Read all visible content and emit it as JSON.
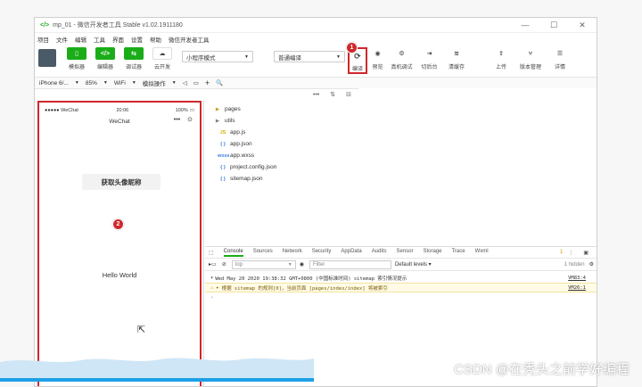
{
  "window": {
    "logo": "</>",
    "title": "mp_01 - 微信开发者工具 Stable v1.02.1911180",
    "controls": [
      "—",
      "☐",
      "✕"
    ]
  },
  "menu": [
    "项目",
    "文件",
    "编辑",
    "工具",
    "界面",
    "设置",
    "帮助",
    "微信开发者工具"
  ],
  "toolbar": {
    "left_buttons": [
      {
        "label": "模拟器",
        "glyph": "▯"
      },
      {
        "label": "编辑器",
        "glyph": "</>"
      },
      {
        "label": "调试器",
        "glyph": "⇆"
      },
      {
        "label": "云开发",
        "glyph": "☁"
      }
    ],
    "mode_select": "小程序模式",
    "compile_select": "普通编译",
    "right_buttons": [
      {
        "label": "编译",
        "glyph": "⟳"
      },
      {
        "label": "预览",
        "glyph": "◉"
      },
      {
        "label": "真机调试",
        "glyph": "⚙"
      },
      {
        "label": "切后台",
        "glyph": "⇥"
      },
      {
        "label": "清缓存",
        "glyph": "≋"
      },
      {
        "label": "上传",
        "glyph": "⇧"
      },
      {
        "label": "版本管理",
        "glyph": "⑂"
      },
      {
        "label": "详情",
        "glyph": "☰"
      }
    ],
    "badge1": "1"
  },
  "devicebar": {
    "device": "iPhone 6/...",
    "zoom": "85%",
    "network": "WiFi",
    "op": "模拟操作",
    "add": "+",
    "search": "🔍"
  },
  "phone": {
    "carrier": "●●●●● WeChat",
    "time": "20:06",
    "battery": "100%",
    "nav_title": "WeChat",
    "capsule_dots": "•••",
    "button_label": "获取头像昵称",
    "hello": "Hello World",
    "badge2": "2"
  },
  "files": [
    {
      "icon": "▶",
      "icon_color": "#c8a020",
      "name": "pages",
      "indent": 0
    },
    {
      "icon": "▶",
      "icon_color": "#7f7f7f",
      "name": "utils",
      "indent": 0
    },
    {
      "icon": "JS",
      "icon_color": "#d4b400",
      "name": "app.js",
      "indent": 1
    },
    {
      "icon": "{ }",
      "icon_color": "#3b7de0",
      "name": "app.json",
      "indent": 1
    },
    {
      "icon": "wxss",
      "icon_color": "#3b7de0",
      "name": "app.wxss",
      "indent": 1
    },
    {
      "icon": "{ }",
      "icon_color": "#3b7de0",
      "name": "project.config.json",
      "indent": 1
    },
    {
      "icon": "{ }",
      "icon_color": "#3b7de0",
      "name": "sitemap.json",
      "indent": 1
    }
  ],
  "console": {
    "tabs": [
      "Console",
      "Sources",
      "Network",
      "Security",
      "AppData",
      "Audits",
      "Sensor",
      "Storage",
      "Trace",
      "Wxml"
    ],
    "warn_count": "1",
    "context": "top",
    "filter_placeholder": "Filter",
    "levels": "Default levels ▾",
    "hidden": "1 hidden",
    "log1": "Wed May 20 2020 19:38:32 GMT+0800 (中国标准时间) sitemap 索引情况提示",
    "log1_src": "VM83:4",
    "log2": "根据 sitemap 的规则[0]，当前页面 [pages/index/index] 将被索引",
    "log2_src": "VM26:1",
    "prompt": "›"
  },
  "watermark": "CSDN @在秃头之前学好编程"
}
